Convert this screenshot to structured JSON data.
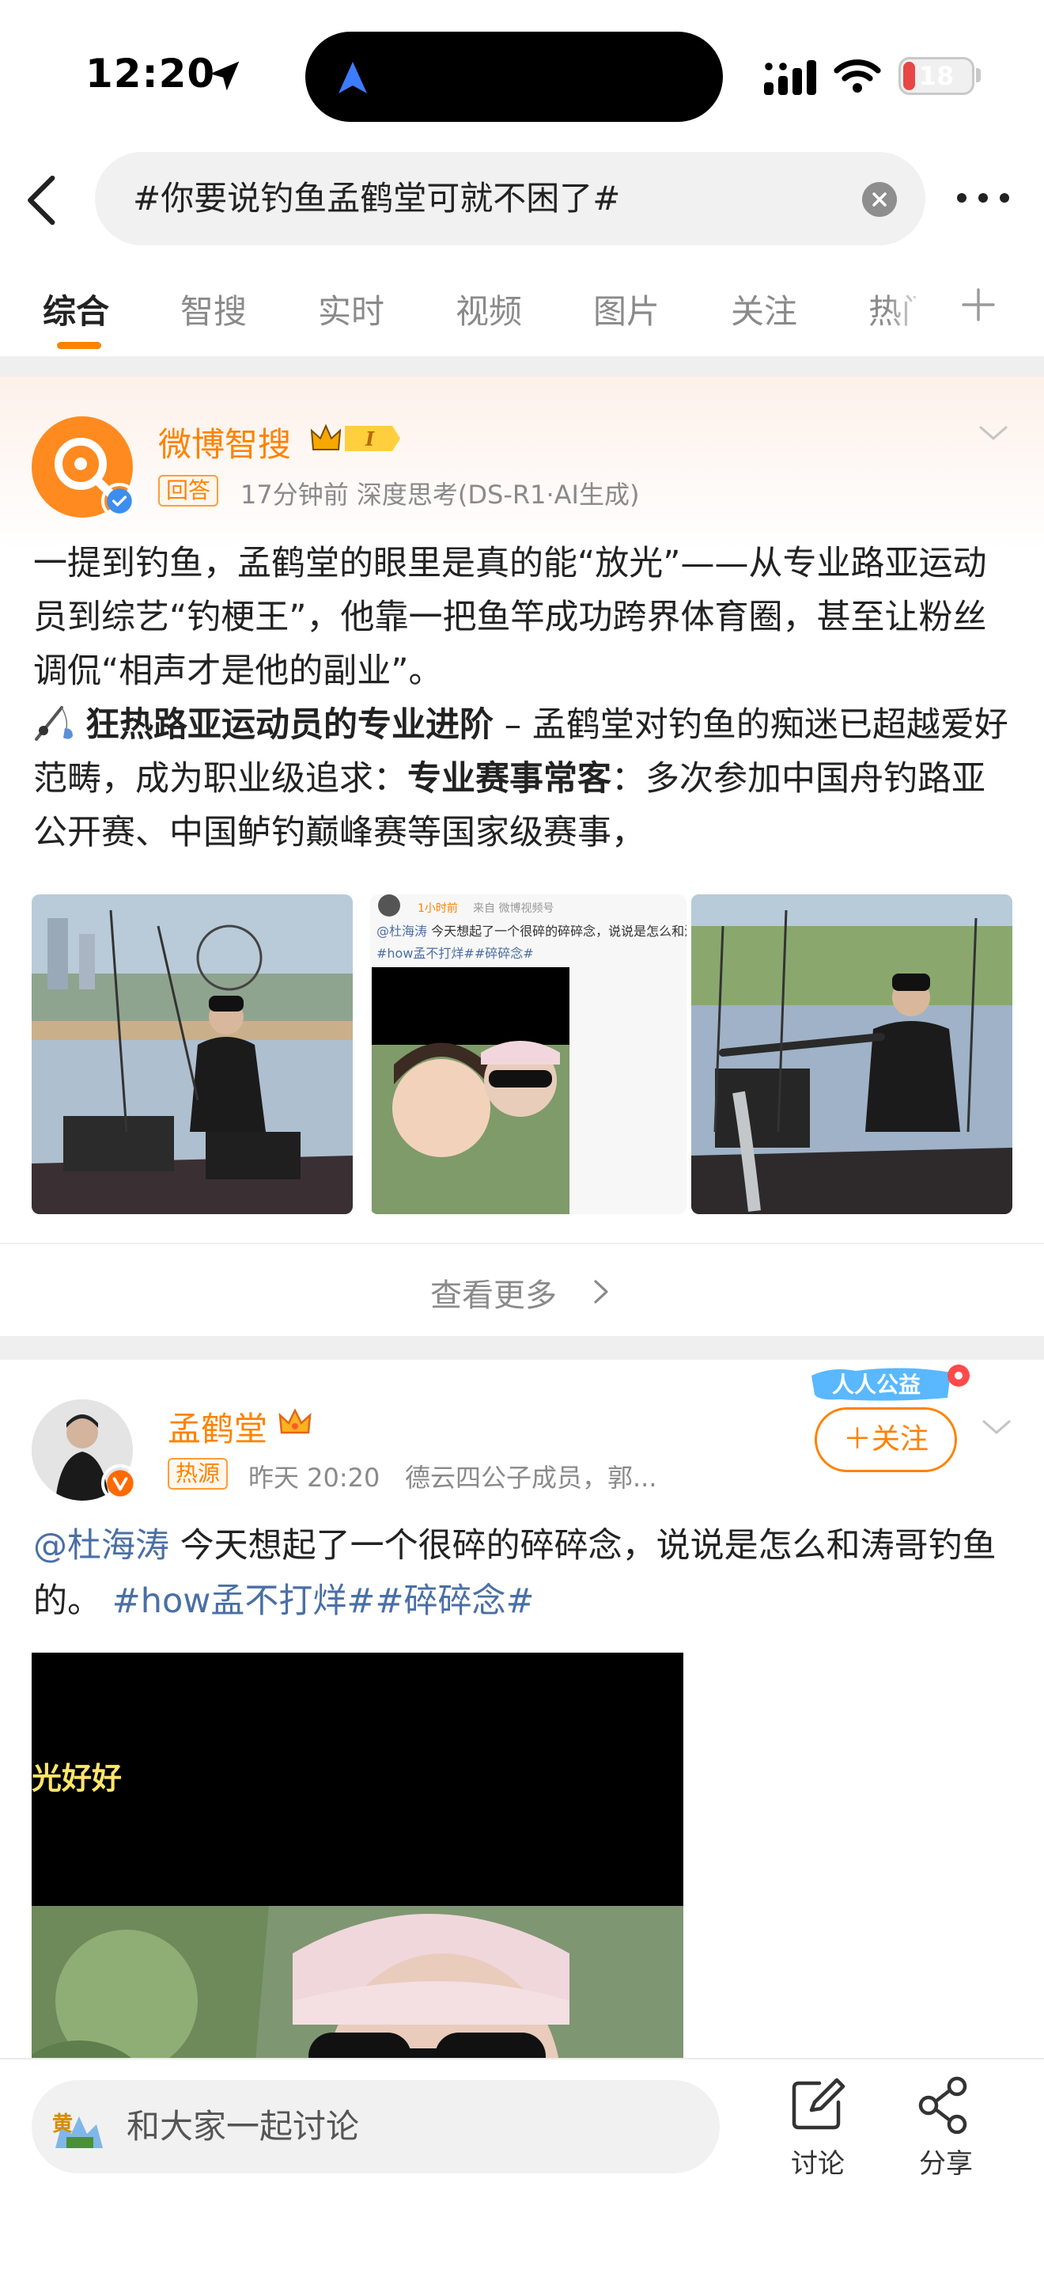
{
  "status_bar": {
    "time": "12:20",
    "battery": "18",
    "battery_level": 0.18
  },
  "search": {
    "query": "#你要说钓鱼孟鹤堂可就不困了#"
  },
  "tabs": [
    "综合",
    "智搜",
    "实时",
    "视频",
    "图片",
    "关注",
    "热门"
  ],
  "ai_card": {
    "author": "微博智搜",
    "badge_level": "I",
    "tag": "回答",
    "meta": "17分钟前  深度思考(DS-R1·AI生成)",
    "para1": "一提到钓鱼，孟鹤堂的眼里是真的能“放光”——从专业路亚运动员到综艺“钓梗王”，他靠一把鱼竿成功跨界体育圈，甚至让粉丝调侃“相声才是他的副业”。",
    "para2_bold": "狂热路亚运动员的专业进阶",
    "para2_mid": " – 孟鹤堂对钓鱼的痴迷已超越爱好范畴，成为职业级追求：",
    "para2_bold2": "专业赛事常客",
    "para2_end": "：多次参加中国舟钓路亚公开赛、中国鲈钓巅峰赛等国家级赛事，",
    "thumb2": {
      "time": "1小时前",
      "source": "来自 微博视频号",
      "mention": "@杜海涛",
      "text": " 今天想起了一个很碎的碎碎念，说说是怎么和涛哥钓鱼的。",
      "tags": "#how孟不打烊##碎碎念#"
    },
    "see_more": "查看更多"
  },
  "post": {
    "author": "孟鹤堂",
    "charity": "人人公益",
    "follow": "＋关注",
    "tag": "热源",
    "time": "昨天 20:20",
    "desc": "德云四公子成员，郭...",
    "mention": "@杜海涛",
    "text": " 今天想起了一个很碎的碎碎念，说说是怎么和涛哥钓鱼的。",
    "tags": " #how孟不打烊##碎碎念#",
    "video_caption": "光好好"
  },
  "bottom_bar": {
    "comment_avatar_text": "黄",
    "comment_placeholder": "和大家一起讨论",
    "discuss": "讨论",
    "share": "分享"
  },
  "colors": {
    "accent": "#ff8200",
    "link": "#4a6fa5",
    "battery": "#e84545"
  },
  "icons": [
    "location-arrow-icon",
    "signal-icon",
    "wifi-icon",
    "back-icon",
    "clear-icon",
    "more-icon",
    "plus-icon",
    "crown-icon",
    "verified-icon",
    "chevron-down-icon",
    "fishing-rod-icon",
    "chevron-right-icon",
    "edit-icon",
    "share-icon"
  ]
}
